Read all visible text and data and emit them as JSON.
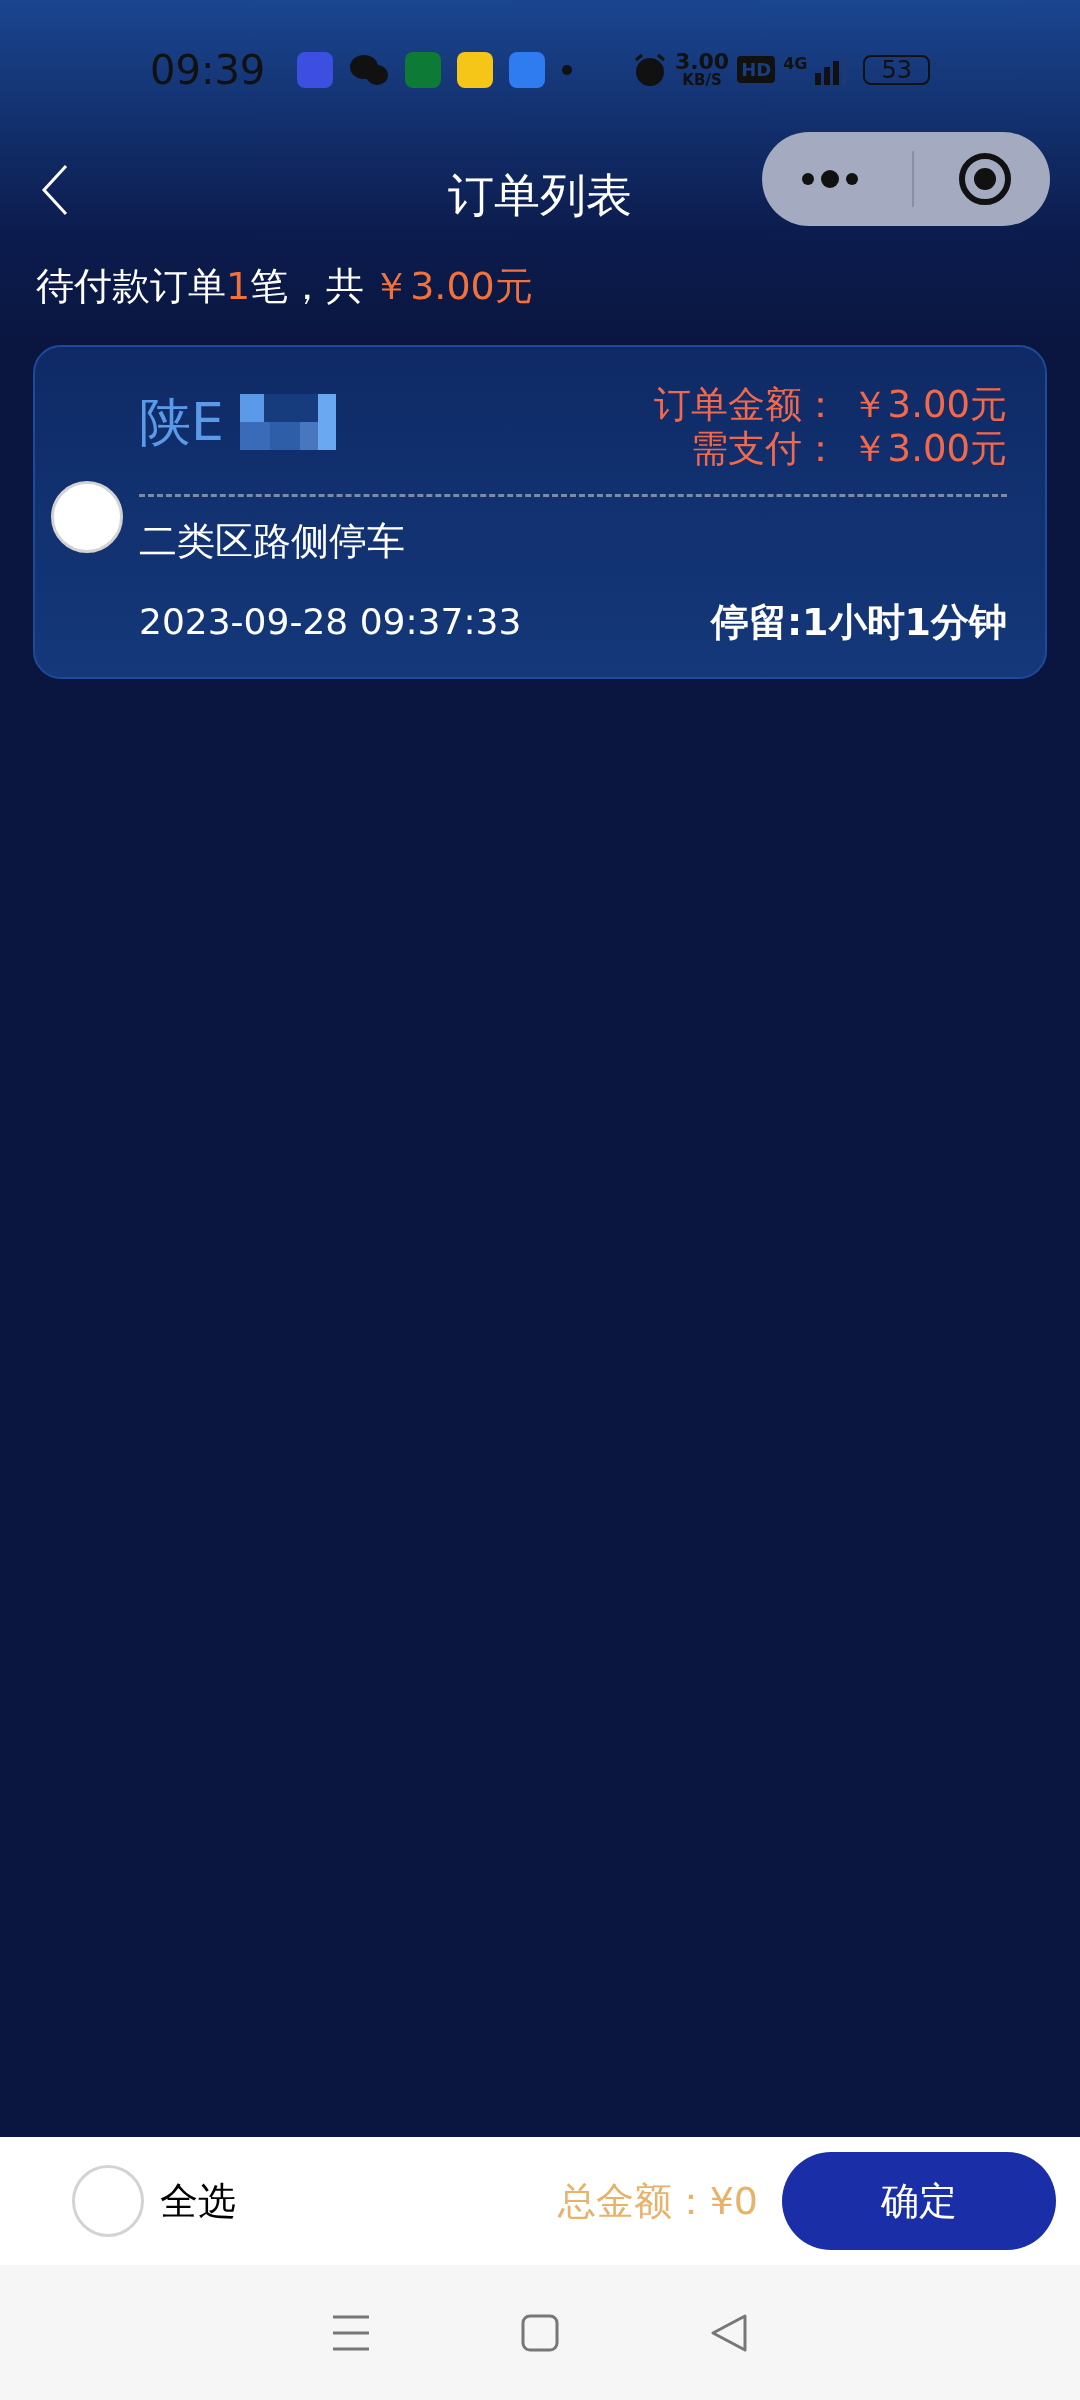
{
  "status_bar": {
    "time": "09:39",
    "speed": "3.00",
    "speed_unit": "KB/S",
    "hd": "HD",
    "network": "4G",
    "battery": "53"
  },
  "header": {
    "title": "订单列表"
  },
  "summary": {
    "prefix": "待付款订单",
    "count": "1",
    "middle": "笔，共",
    "total": "￥3.00元"
  },
  "orders": [
    {
      "plate": "陕E",
      "amount_label": "订单金额：",
      "amount": "￥3.00元",
      "due_label": "需支付：",
      "due": "￥3.00元",
      "category": "二类区路侧停车",
      "time": "2023-09-28 09:37:33",
      "duration": "停留:1小时1分钟",
      "selected": false
    }
  ],
  "footer": {
    "select_all": {
      "label": "全选",
      "selected": false
    },
    "total_label": "总金额：",
    "total": "¥0",
    "confirm": "确定"
  }
}
